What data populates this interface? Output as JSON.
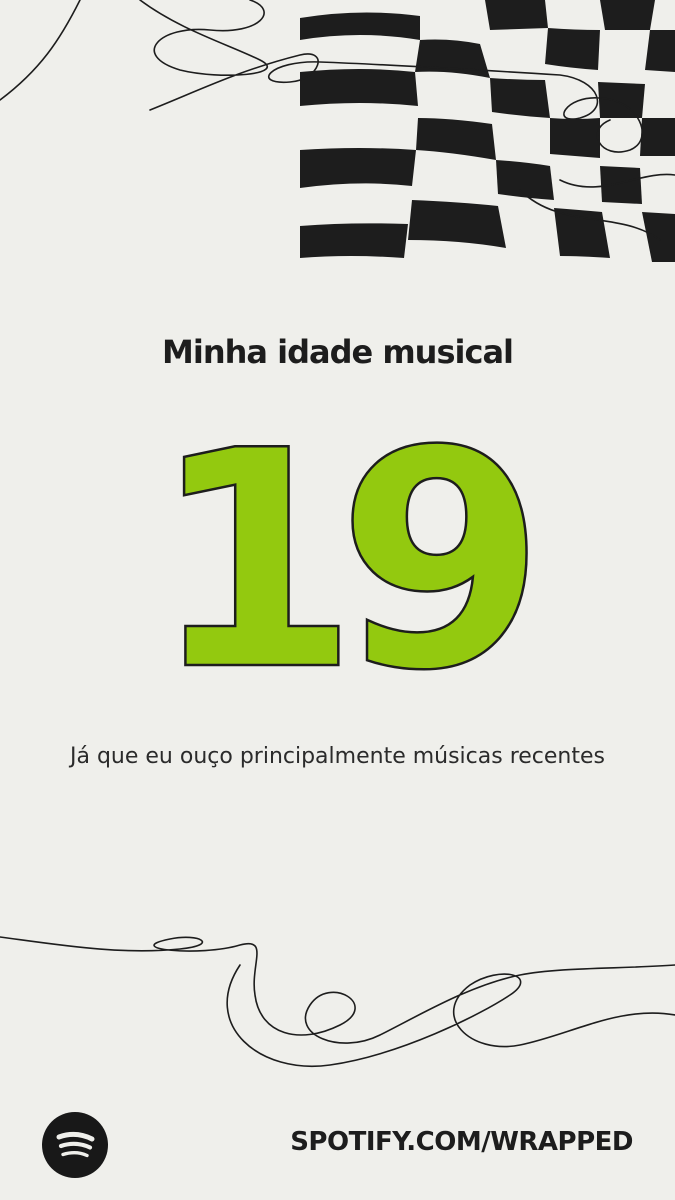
{
  "headline": "Minha idade musical",
  "age_value": "19",
  "caption": "Já que eu ouço principalmente músicas recentes",
  "footer": {
    "url": "SPOTIFY.COM/WRAPPED",
    "logo_icon": "spotify-logo-icon"
  },
  "colors": {
    "background": "#efefeb",
    "accent_green": "#93c90f",
    "ink": "#1d1d1d"
  }
}
